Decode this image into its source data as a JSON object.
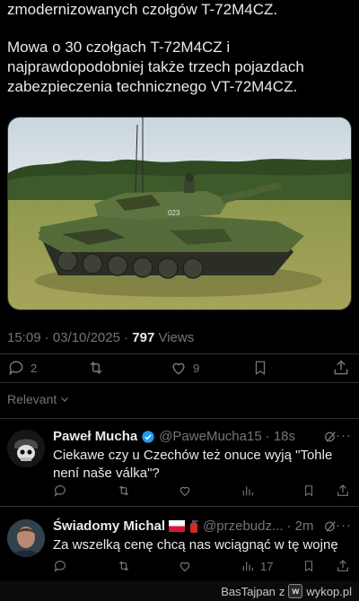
{
  "tweet": {
    "line1": "zmodernizowanych czołgów T-72M4CZ.",
    "paragraph": "Mowa o 30 czołgach T-72M4CZ i najprawdopodobniej także trzech pojazdach zabezpieczenia technicznego VT-72M4CZ.",
    "tank_number": "023",
    "time": "15:09 · 03/10/2025 · ",
    "views_count": "797",
    "views_label": " Views",
    "replies": "2",
    "likes": "9"
  },
  "filter": {
    "label": "Relevant"
  },
  "replies": [
    {
      "name": "Paweł Mucha",
      "verified": true,
      "handle": "@PaweMucha15",
      "time": "· 18s",
      "text": "Ciekawe czy u Czechów też onuce wyją \"Tohle není naše válka\"?",
      "views": ""
    },
    {
      "name": "Świadomy Michal",
      "handle": "@przebudz...",
      "time": "· 2m",
      "text": "Za wszelką cenę chcą nas wciągnąć w tę wojnę",
      "views": "17"
    }
  ],
  "more_label": "···",
  "footer": {
    "user": "BasTajpan",
    "via": "z",
    "brand": "wykop.pl"
  },
  "colors": {
    "background": "#000000",
    "text": "#e7e9ea",
    "muted": "#71767b",
    "verified": "#1d9bf0",
    "divider": "#2f3336"
  }
}
